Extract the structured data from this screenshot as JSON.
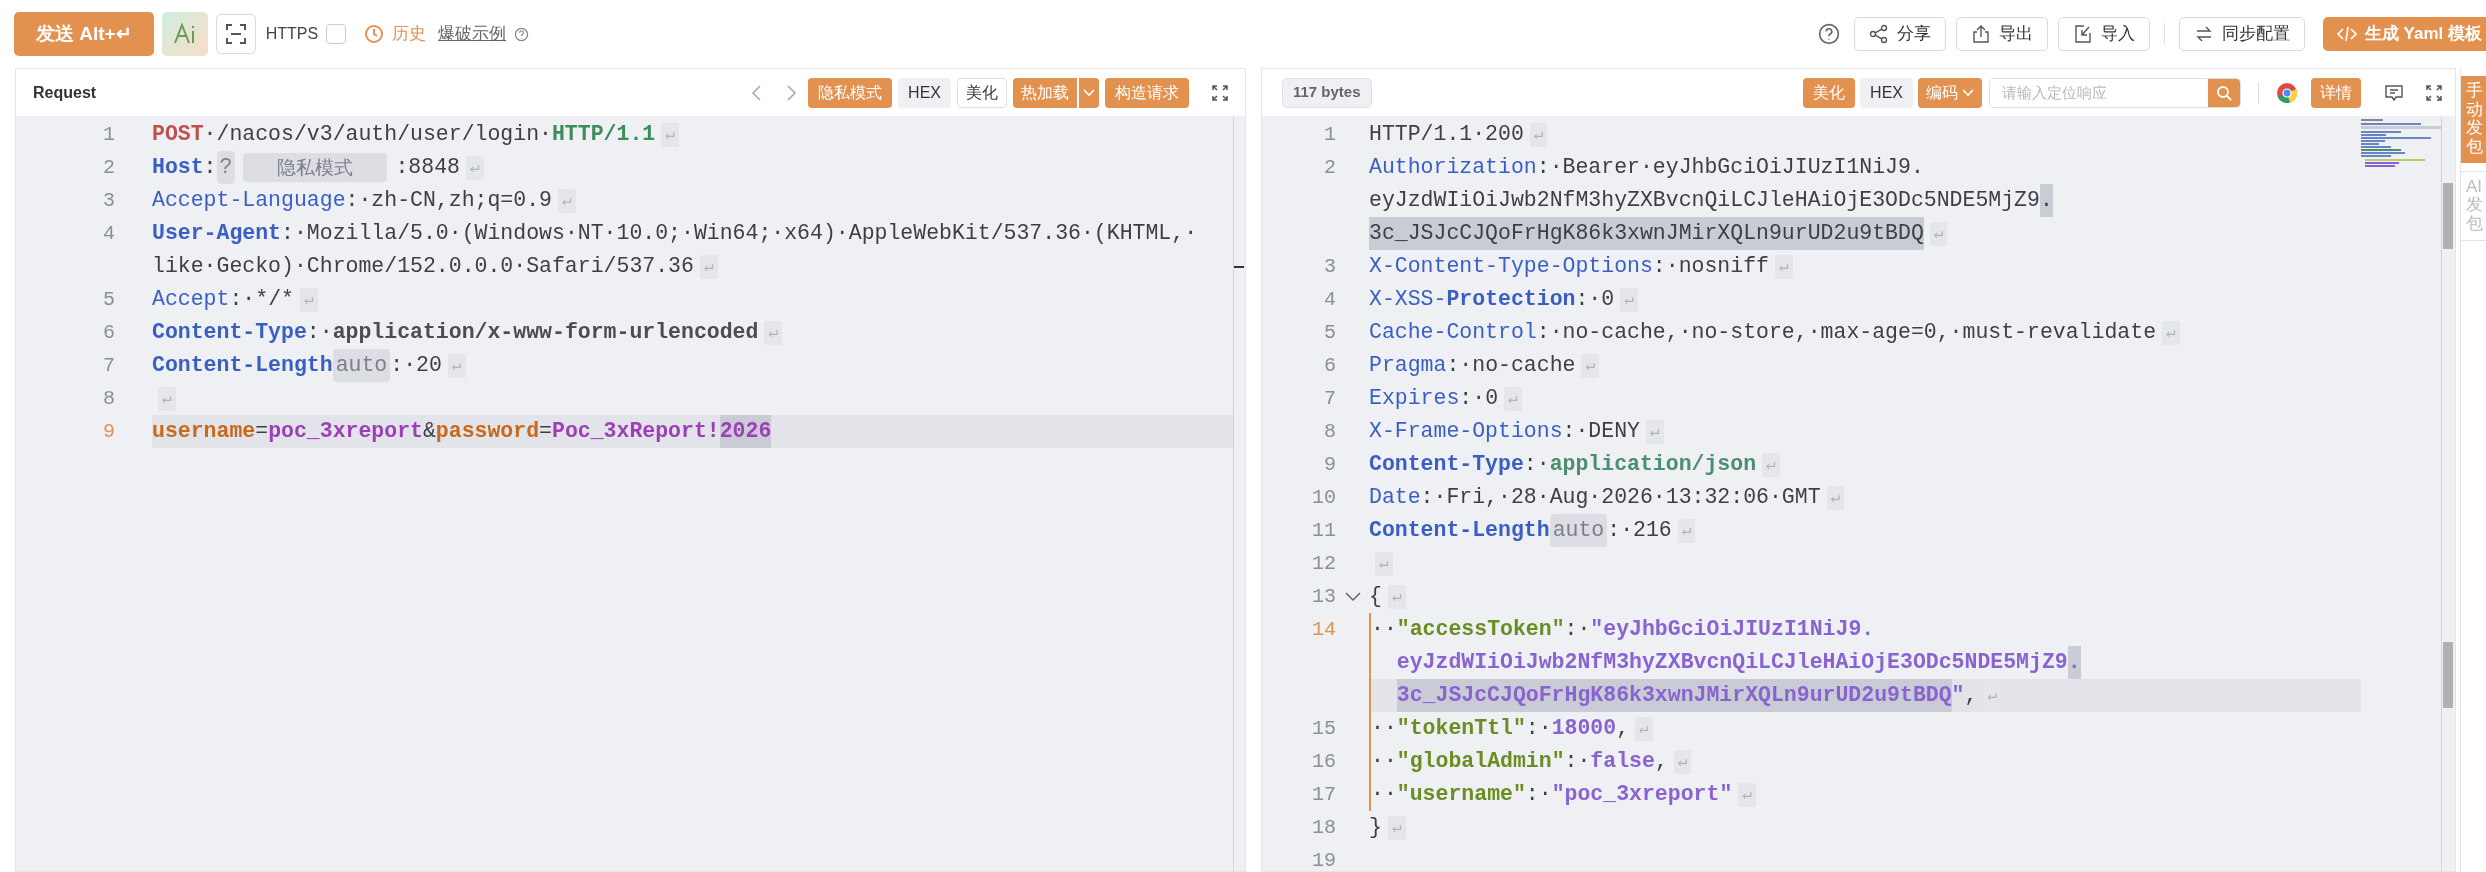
{
  "top_bar": {
    "send_button": {
      "label": "发送 Alt+↵"
    },
    "https": {
      "label": "HTTPS",
      "checked": false
    },
    "history": {
      "label": "历史"
    },
    "fuzz_example": {
      "label": "爆破示例"
    },
    "actions": [
      {
        "label": "分享"
      },
      {
        "label": "导出"
      },
      {
        "label": "导入"
      },
      {
        "label": "同步配置"
      }
    ],
    "generate_button": {
      "label": "生成 Yaml 模板"
    }
  },
  "request": {
    "title": "Request",
    "buttons": [
      {
        "label": "隐私模式",
        "kind": "primary"
      },
      {
        "label": "HEX",
        "kind": "secondary"
      },
      {
        "label": "美化",
        "kind": "outline"
      },
      {
        "label": "热加载",
        "kind": "split"
      },
      {
        "label": "构造请求",
        "kind": "primary"
      }
    ],
    "lines": [
      {
        "number": "1",
        "active": false,
        "eol": "↵",
        "rows": [
          {
            "tokens": [
              {
                "kind": "method",
                "text": "POST"
              },
              {
                "kind": "plain",
                "text": "·/nacos/v3/auth/user/login·"
              },
              {
                "kind": "version",
                "text": "HTTP/1.1"
              }
            ]
          }
        ]
      },
      {
        "number": "2",
        "active": false,
        "eol": "↵",
        "rows": [
          {
            "tokens": [
              {
                "kind": "keyb",
                "text": "Host"
              },
              {
                "kind": "plain",
                "text": ":"
              },
              {
                "kind": "chip",
                "text": "?"
              },
              {
                "kind": "mask",
                "text": "隐私模式"
              },
              {
                "kind": "plain",
                "text": ":8848"
              }
            ]
          }
        ]
      },
      {
        "number": "3",
        "active": false,
        "eol": "↵",
        "rows": [
          {
            "tokens": [
              {
                "kind": "key",
                "text": "Accept-Language"
              },
              {
                "kind": "plain",
                "text": ":·zh-CN,zh;q=0.9"
              }
            ]
          }
        ]
      },
      {
        "number": "4",
        "active": false,
        "eol": "↵",
        "rows": [
          {
            "tokens": [
              {
                "kind": "keyb",
                "text": "User-Agent"
              },
              {
                "kind": "plain",
                "text": ":·Mozilla/5.0·(Windows·NT·10.0;·Win64;·x64)·AppleWebKit/537.36·(KHTML,·"
              }
            ]
          },
          {
            "tokens": [
              {
                "kind": "plain",
                "text": "like·Gecko)·Chrome/152.0.0.0·Safari/537.36"
              }
            ]
          }
        ]
      },
      {
        "number": "5",
        "active": false,
        "eol": "↵",
        "rows": [
          {
            "tokens": [
              {
                "kind": "key",
                "text": "Accept"
              },
              {
                "kind": "plain",
                "text": ":·*/*"
              }
            ]
          }
        ]
      },
      {
        "number": "6",
        "active": false,
        "eol": "↵",
        "rows": [
          {
            "tokens": [
              {
                "kind": "keyb",
                "text": "Content-Type"
              },
              {
                "kind": "plain",
                "text": ":·"
              },
              {
                "kind": "valb",
                "text": "application/x-www-form-urlencoded"
              }
            ]
          }
        ]
      },
      {
        "number": "7",
        "active": false,
        "eol": "↵",
        "rows": [
          {
            "tokens": [
              {
                "kind": "keyb",
                "text": "Content-Length"
              },
              {
                "kind": "chip",
                "text": "auto"
              },
              {
                "kind": "plain",
                "text": ":·20"
              }
            ]
          }
        ]
      },
      {
        "number": "8",
        "active": false,
        "eol": "↵"
      },
      {
        "number": "9",
        "active": true,
        "rows": [
          {
            "tokens": [
              {
                "kind": "formkey",
                "text": "username",
                "highlighted": false
              },
              {
                "kind": "plain",
                "text": "=",
                "highlighted": false
              },
              {
                "kind": "formval",
                "text": "poc_3xreport",
                "highlighted": false
              },
              {
                "kind": "plain",
                "text": "&",
                "highlighted": false
              },
              {
                "kind": "formkey",
                "text": "password",
                "highlighted": false
              },
              {
                "kind": "plain",
                "text": "=",
                "highlighted": false
              },
              {
                "kind": "formval",
                "text": "Poc_3xReport!",
                "highlighted": false
              },
              {
                "kind": "formval",
                "text": "2026",
                "highlighted": true
              }
            ]
          }
        ]
      }
    ]
  },
  "response": {
    "size": "117 bytes",
    "buttons": [
      {
        "label": "美化",
        "kind": "primary"
      },
      {
        "label": "HEX",
        "kind": "secondary"
      },
      {
        "label": "编码",
        "kind": "dropdown"
      }
    ],
    "search": {
      "placeholder": "请输入定位响应"
    },
    "details_button": {
      "label": "详情"
    },
    "lines": [
      {
        "number": "1",
        "active": false,
        "eol": "↵",
        "rows": [
          {
            "tokens": [
              {
                "kind": "plain",
                "text": "HTTP/1.1·200"
              }
            ]
          }
        ]
      },
      {
        "number": "2",
        "active": false,
        "eol": "↵",
        "rows": [
          {
            "tokens": [
              {
                "kind": "key",
                "text": "Authorization",
                "highlighted": false
              },
              {
                "kind": "plain",
                "text": ":·Bearer·eyJhbGciOiJIUzI1NiJ9.",
                "highlighted": false
              }
            ]
          },
          {
            "tokens": [
              {
                "kind": "plain",
                "text": "eyJzdWIiOiJwb2NfM3hyZXBvcnQiLCJleHAiOjE3ODc5NDE5MjZ9",
                "highlighted": false
              },
              {
                "kind": "plain",
                "text": ".",
                "highlighted": true
              }
            ]
          },
          {
            "tokens": [
              {
                "kind": "plain",
                "text": "3c_JSJcCJQoFrHgK86k3xwnJMirXQLn9urUD2u9tBDQ",
                "highlighted": true
              }
            ]
          }
        ]
      },
      {
        "number": "3",
        "active": false,
        "eol": "↵",
        "rows": [
          {
            "tokens": [
              {
                "kind": "key",
                "text": "X-Content-Type-Options"
              },
              {
                "kind": "plain",
                "text": ":·nosniff"
              }
            ]
          }
        ]
      },
      {
        "number": "4",
        "active": false,
        "eol": "↵",
        "rows": [
          {
            "tokens": [
              {
                "kind": "key",
                "text": "X-XSS-"
              },
              {
                "kind": "keyb",
                "text": "Protection"
              },
              {
                "kind": "plain",
                "text": ":·0"
              }
            ]
          }
        ]
      },
      {
        "number": "5",
        "active": false,
        "eol": "↵",
        "rows": [
          {
            "tokens": [
              {
                "kind": "key",
                "text": "Cache-Control"
              },
              {
                "kind": "plain",
                "text": ":·no-cache,·no-store,·max-age=0,·must-revalidate"
              }
            ]
          }
        ]
      },
      {
        "number": "6",
        "active": false,
        "eol": "↵",
        "rows": [
          {
            "tokens": [
              {
                "kind": "key",
                "text": "Pragma"
              },
              {
                "kind": "plain",
                "text": ":·no-cache"
              }
            ]
          }
        ]
      },
      {
        "number": "7",
        "active": false,
        "eol": "↵",
        "rows": [
          {
            "tokens": [
              {
                "kind": "key",
                "text": "Expires"
              },
              {
                "kind": "plain",
                "text": ":·0"
              }
            ]
          }
        ]
      },
      {
        "number": "8",
        "active": false,
        "eol": "↵",
        "rows": [
          {
            "tokens": [
              {
                "kind": "key",
                "text": "X-Frame-Options"
              },
              {
                "kind": "plain",
                "text": ":·DENY"
              }
            ]
          }
        ]
      },
      {
        "number": "9",
        "active": false,
        "eol": "↵",
        "rows": [
          {
            "tokens": [
              {
                "kind": "keyb",
                "text": "Content-Type"
              },
              {
                "kind": "plain",
                "text": ":·"
              },
              {
                "kind": "strval",
                "text": "application/json"
              }
            ]
          }
        ]
      },
      {
        "number": "10",
        "active": false,
        "eol": "↵",
        "rows": [
          {
            "tokens": [
              {
                "kind": "key",
                "text": "Date"
              },
              {
                "kind": "plain",
                "text": ":·Fri,·28·Aug·2026·13:32:06·GMT"
              }
            ]
          }
        ]
      },
      {
        "number": "11",
        "active": false,
        "eol": "↵",
        "rows": [
          {
            "tokens": [
              {
                "kind": "keyb",
                "text": "Content-Length"
              },
              {
                "kind": "chip",
                "text": "auto"
              },
              {
                "kind": "plain",
                "text": ":·216"
              }
            ]
          }
        ]
      },
      {
        "number": "12",
        "active": false,
        "eol": "↵"
      },
      {
        "number": "13",
        "active": false,
        "eol": "↵",
        "rows": [
          {
            "tokens": [
              {
                "kind": "plain",
                "text": "{"
              }
            ]
          }
        ],
        "children": [
          {
            "number": "14",
            "active": true,
            "eol": "↵",
            "rows": [
              {
                "tokens": [
                  {
                    "kind": "plain",
                    "text": "··",
                    "highlighted": false
                  },
                  {
                    "kind": "jkey",
                    "text": "\"accessToken\"",
                    "highlighted": false
                  },
                  {
                    "kind": "plain",
                    "text": ":·",
                    "highlighted": false
                  },
                  {
                    "kind": "jstr",
                    "text": "\"eyJhbGciOiJIUzI1NiJ9.",
                    "highlighted": false
                  }
                ]
              },
              {
                "tokens": [
                  {
                    "kind": "jstr",
                    "text": "eyJzdWIiOiJwb2NfM3hyZXBvcnQiLCJleHAiOjE3ODc5NDE5MjZ9",
                    "highlighted": false
                  },
                  {
                    "kind": "jstr",
                    "text": ".",
                    "highlighted": true
                  }
                ]
              },
              {
                "tokens": [
                  {
                    "kind": "jstr",
                    "text": "3c_JSJcCJQoFrHgK86k3xwnJMirXQLn9urUD2u9tBDQ",
                    "highlighted": true
                  },
                  {
                    "kind": "jstr",
                    "text": "\"",
                    "highlighted": false
                  },
                  {
                    "kind": "plain",
                    "text": ",",
                    "highlighted": false
                  }
                ]
              }
            ]
          },
          {
            "number": "15",
            "active": false,
            "eol": "↵",
            "rows": [
              {
                "tokens": [
                  {
                    "kind": "plain",
                    "text": "··"
                  },
                  {
                    "kind": "jkey",
                    "text": "\"tokenTtl\""
                  },
                  {
                    "kind": "plain",
                    "text": ":·"
                  },
                  {
                    "kind": "jstr",
                    "text": "18000"
                  },
                  {
                    "kind": "plain",
                    "text": ","
                  }
                ]
              }
            ]
          },
          {
            "number": "16",
            "active": false,
            "eol": "↵",
            "rows": [
              {
                "tokens": [
                  {
                    "kind": "plain",
                    "text": "··"
                  },
                  {
                    "kind": "jkey",
                    "text": "\"globalAdmin\""
                  },
                  {
                    "kind": "plain",
                    "text": ":·"
                  },
                  {
                    "kind": "jstr",
                    "text": "false"
                  },
                  {
                    "kind": "plain",
                    "text": ","
                  }
                ]
              }
            ]
          },
          {
            "number": "17",
            "active": false,
            "eol": "↵",
            "rows": [
              {
                "tokens": [
                  {
                    "kind": "plain",
                    "text": "··"
                  },
                  {
                    "kind": "jkey",
                    "text": "\"username\""
                  },
                  {
                    "kind": "plain",
                    "text": ":·"
                  },
                  {
                    "kind": "jstr",
                    "text": "\"poc_3xreport\""
                  }
                ]
              }
            ]
          }
        ]
      },
      {
        "number": "18",
        "active": false,
        "eol": "↵",
        "rows": [
          {
            "tokens": [
              {
                "kind": "plain",
                "text": "}"
              }
            ]
          }
        ]
      },
      {
        "number": "19",
        "active": false
      }
    ]
  },
  "side_tabs": [
    {
      "label": "手动发包",
      "selected": true
    },
    {
      "label": "AI发包",
      "selected": false
    }
  ]
}
